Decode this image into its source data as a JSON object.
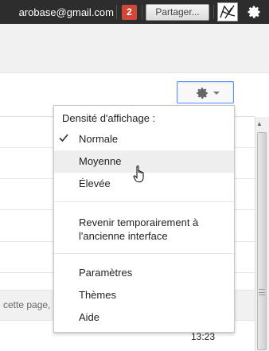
{
  "topbar": {
    "email": "arobase@gmail.com",
    "notification_count": "2",
    "share_label": "Partager...",
    "icons": [
      "avatar-image",
      "gear-icon"
    ]
  },
  "settings_button": {
    "icon": "gear-icon",
    "caret": "chevron-down-icon"
  },
  "menu": {
    "heading": "Densité d'affichage :",
    "density_options": [
      {
        "label": "Normale",
        "checked": true
      },
      {
        "label": "Moyenne",
        "hovered": true
      },
      {
        "label": "Élevée"
      }
    ],
    "revert_label": "Revenir temporairement à l'ancienne interface",
    "items": [
      {
        "label": "Paramètres"
      },
      {
        "label": "Thèmes"
      },
      {
        "label": "Aide"
      }
    ]
  },
  "list": {
    "footer_text": "cette page,",
    "time": "13:23"
  },
  "colors": {
    "topbar": "#2d2d2d",
    "notification": "#d14836",
    "focus_border": "#4d90fe"
  }
}
